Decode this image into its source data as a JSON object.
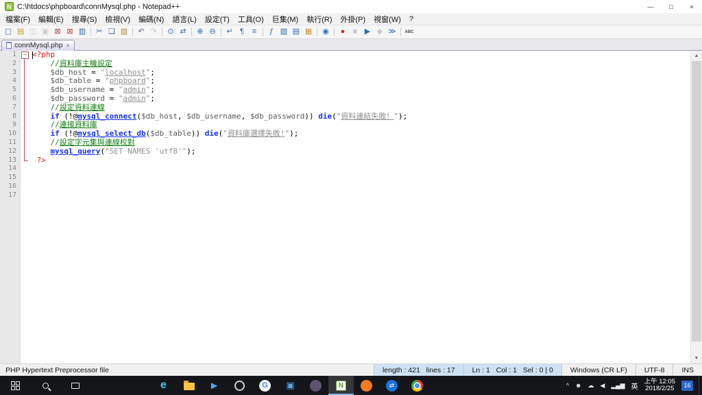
{
  "titlebar": {
    "icon_letter": "N",
    "title": "C:\\htdocs\\phpboard\\connMysql.php - Notepad++",
    "minimize_glyph": "—",
    "maximize_glyph": "□",
    "close_glyph": "×"
  },
  "menubar": {
    "items": [
      {
        "key": "file",
        "label": "檔案(F)"
      },
      {
        "key": "edit",
        "label": "編輯(E)"
      },
      {
        "key": "search",
        "label": "搜尋(S)"
      },
      {
        "key": "view",
        "label": "檢視(V)"
      },
      {
        "key": "encoding",
        "label": "編碼(N)"
      },
      {
        "key": "language",
        "label": "語言(L)"
      },
      {
        "key": "settings",
        "label": "設定(T)"
      },
      {
        "key": "tools",
        "label": "工具(O)"
      },
      {
        "key": "macro",
        "label": "巨集(M)"
      },
      {
        "key": "run",
        "label": "執行(R)"
      },
      {
        "key": "plugins",
        "label": "外掛(P)"
      },
      {
        "key": "window",
        "label": "視窗(W)"
      },
      {
        "key": "help",
        "label": "?"
      }
    ]
  },
  "toolbar": {
    "items": [
      {
        "name": "new-file",
        "glyph": "▢",
        "color": "#3a66a8"
      },
      {
        "name": "open-file",
        "glyph": "▤",
        "color": "#c79a3a"
      },
      {
        "name": "save-file",
        "glyph": "◫",
        "color": "#8a8a8a",
        "disabled": true
      },
      {
        "name": "save-all",
        "glyph": "▣",
        "color": "#8a8a8a",
        "disabled": true
      },
      {
        "name": "close-file",
        "glyph": "⊠",
        "color": "#b04a4a"
      },
      {
        "name": "close-all",
        "glyph": "⊠",
        "color": "#b04a4a"
      },
      {
        "name": "print",
        "glyph": "▥",
        "color": "#3a66a8"
      },
      {
        "sep": true
      },
      {
        "name": "cut",
        "glyph": "✂",
        "color": "#3a66a8"
      },
      {
        "name": "copy",
        "glyph": "❏",
        "color": "#3a66a8"
      },
      {
        "name": "paste",
        "glyph": "▨",
        "color": "#b58a3a"
      },
      {
        "sep": true
      },
      {
        "name": "undo",
        "glyph": "↶",
        "color": "#7d5bb5"
      },
      {
        "name": "redo",
        "glyph": "↷",
        "color": "#8a8a8a",
        "disabled": true
      },
      {
        "sep": true
      },
      {
        "name": "find",
        "glyph": "⊙",
        "color": "#2f6db3"
      },
      {
        "name": "replace",
        "glyph": "⇄",
        "color": "#2f6db3"
      },
      {
        "sep": true
      },
      {
        "name": "zoom-in",
        "glyph": "⊕",
        "color": "#2f6db3"
      },
      {
        "name": "zoom-out",
        "glyph": "⊖",
        "color": "#2f6db3"
      },
      {
        "sep": true
      },
      {
        "name": "word-wrap",
        "glyph": "↵",
        "color": "#2f6db3"
      },
      {
        "name": "show-all-characters",
        "glyph": "¶",
        "color": "#2f6db3"
      },
      {
        "name": "indent-guide",
        "glyph": "≡",
        "color": "#2f6db3"
      },
      {
        "sep": true
      },
      {
        "name": "function-list",
        "glyph": "ƒ",
        "color": "#2f6db3"
      },
      {
        "name": "document-map",
        "glyph": "▧",
        "color": "#2f6db3"
      },
      {
        "name": "document-list",
        "glyph": "▤",
        "color": "#2f6db3"
      },
      {
        "name": "folder-as-workspace",
        "glyph": "▦",
        "color": "#c79a3a"
      },
      {
        "sep": true
      },
      {
        "name": "monitoring",
        "glyph": "◉",
        "color": "#2f6db3"
      },
      {
        "sep": true
      },
      {
        "name": "record-macro",
        "glyph": "●",
        "color": "#cc2a2a"
      },
      {
        "name": "stop-recording",
        "glyph": "■",
        "color": "#8a8a8a",
        "disabled": true
      },
      {
        "name": "playback-macro",
        "glyph": "▶",
        "color": "#2f6db3"
      },
      {
        "name": "save-macro",
        "glyph": "◆",
        "color": "#8a8a8a",
        "disabled": true
      },
      {
        "name": "run-macro-multiple",
        "glyph": "≫",
        "color": "#2f6db3"
      },
      {
        "sep": true
      },
      {
        "name": "spell-check",
        "glyph": "ABC",
        "color": "#444444",
        "fs": 6,
        "bold": true
      }
    ]
  },
  "tabbar": {
    "label": "connMysql.php",
    "close_glyph": "×"
  },
  "editor": {
    "scrollbar": {
      "up": "▲",
      "down": "▼"
    },
    "lines": [
      {
        "num": 1,
        "fold": "start",
        "tokens": [
          {
            "t": "<?php",
            "c": "tag"
          }
        ]
      },
      {
        "num": 2,
        "fold": "line",
        "tokens": [
          {
            "t": "    ",
            "c": "op"
          },
          {
            "t": "//",
            "c": "com"
          },
          {
            "t": "資料庫主機設定",
            "c": "com u"
          }
        ]
      },
      {
        "num": 3,
        "fold": "line",
        "tokens": [
          {
            "t": "    ",
            "c": "op"
          },
          {
            "t": "$db_host",
            "c": "var"
          },
          {
            "t": " = ",
            "c": "op"
          },
          {
            "t": "\"",
            "c": "str"
          },
          {
            "t": "localhost",
            "c": "str u"
          },
          {
            "t": "\"",
            "c": "str"
          },
          {
            "t": ";",
            "c": "op"
          }
        ]
      },
      {
        "num": 4,
        "fold": "line",
        "tokens": [
          {
            "t": "    ",
            "c": "op"
          },
          {
            "t": "$db_table",
            "c": "var"
          },
          {
            "t": " = ",
            "c": "op"
          },
          {
            "t": "\"",
            "c": "str"
          },
          {
            "t": "phpboard",
            "c": "str u"
          },
          {
            "t": "\"",
            "c": "str"
          },
          {
            "t": ";",
            "c": "op"
          }
        ]
      },
      {
        "num": 5,
        "fold": "line",
        "tokens": [
          {
            "t": "    ",
            "c": "op"
          },
          {
            "t": "$db_username",
            "c": "var"
          },
          {
            "t": " = ",
            "c": "op"
          },
          {
            "t": "\"",
            "c": "str"
          },
          {
            "t": "admin",
            "c": "str u"
          },
          {
            "t": "\"",
            "c": "str"
          },
          {
            "t": ";",
            "c": "op"
          }
        ]
      },
      {
        "num": 6,
        "fold": "line",
        "tokens": [
          {
            "t": "    ",
            "c": "op"
          },
          {
            "t": "$db_password",
            "c": "var"
          },
          {
            "t": " = ",
            "c": "op"
          },
          {
            "t": "\"",
            "c": "str"
          },
          {
            "t": "admin",
            "c": "str u"
          },
          {
            "t": "\"",
            "c": "str"
          },
          {
            "t": ";",
            "c": "op"
          }
        ]
      },
      {
        "num": 7,
        "fold": "line",
        "tokens": [
          {
            "t": "    ",
            "c": "op"
          },
          {
            "t": "//",
            "c": "com"
          },
          {
            "t": "設定資料連線",
            "c": "com u"
          }
        ]
      },
      {
        "num": 8,
        "fold": "line",
        "tokens": [
          {
            "t": "    ",
            "c": "op"
          },
          {
            "t": "if",
            "c": "kw"
          },
          {
            "t": " (!@",
            "c": "op"
          },
          {
            "t": "mysql_connect",
            "c": "fn u"
          },
          {
            "t": "(",
            "c": "op"
          },
          {
            "t": "$db_host",
            "c": "var"
          },
          {
            "t": ", ",
            "c": "op"
          },
          {
            "t": "$db_username",
            "c": "var"
          },
          {
            "t": ", ",
            "c": "op"
          },
          {
            "t": "$db_password",
            "c": "var"
          },
          {
            "t": ")) ",
            "c": "op"
          },
          {
            "t": "die",
            "c": "kw"
          },
          {
            "t": "(",
            "c": "op"
          },
          {
            "t": "\"",
            "c": "str"
          },
          {
            "t": "資料連結失敗！",
            "c": "str u"
          },
          {
            "t": "\"",
            "c": "str"
          },
          {
            "t": ");",
            "c": "op"
          }
        ]
      },
      {
        "num": 9,
        "fold": "line",
        "tokens": [
          {
            "t": "    ",
            "c": "op"
          },
          {
            "t": "//",
            "c": "com"
          },
          {
            "t": "連接資料庫",
            "c": "com u"
          }
        ]
      },
      {
        "num": 10,
        "fold": "line",
        "tokens": [
          {
            "t": "    ",
            "c": "op"
          },
          {
            "t": "if",
            "c": "kw"
          },
          {
            "t": " (!@",
            "c": "op"
          },
          {
            "t": "mysql_select_db",
            "c": "fn u"
          },
          {
            "t": "(",
            "c": "op"
          },
          {
            "t": "$db_table",
            "c": "var"
          },
          {
            "t": ")) ",
            "c": "op"
          },
          {
            "t": "die",
            "c": "kw"
          },
          {
            "t": "(",
            "c": "op"
          },
          {
            "t": "\"",
            "c": "str"
          },
          {
            "t": "資料庫選擇失敗!",
            "c": "str u"
          },
          {
            "t": "\"",
            "c": "str"
          },
          {
            "t": ");",
            "c": "op"
          }
        ]
      },
      {
        "num": 11,
        "fold": "line",
        "tokens": [
          {
            "t": "    ",
            "c": "op"
          },
          {
            "t": "//",
            "c": "com"
          },
          {
            "t": "設定字元集與連線校對",
            "c": "com u"
          }
        ]
      },
      {
        "num": 12,
        "fold": "line",
        "tokens": [
          {
            "t": "    ",
            "c": "op"
          },
          {
            "t": "mysql_query",
            "c": "fn u"
          },
          {
            "t": "(",
            "c": "op"
          },
          {
            "t": "\"SET NAMES 'utf8'\"",
            "c": "str"
          },
          {
            "t": ");",
            "c": "op"
          }
        ]
      },
      {
        "num": 13,
        "fold": "end",
        "tokens": [
          {
            "t": " ",
            "c": "op"
          },
          {
            "t": "?>",
            "c": "tag"
          }
        ]
      },
      {
        "num": 14,
        "fold": "none",
        "tokens": []
      },
      {
        "num": 15,
        "fold": "none",
        "tokens": []
      },
      {
        "num": 16,
        "fold": "none",
        "tokens": []
      },
      {
        "num": 17,
        "fold": "none",
        "tokens": []
      }
    ]
  },
  "statusbar": {
    "doctype": "PHP Hypertext Preprocessor file",
    "length_lines": "length : 421   lines : 17",
    "cursor": "Ln : 1   Col : 1   Sel : 0 | 0",
    "eol": "Windows (CR LF)",
    "encoding": "UTF-8",
    "mode": "INS"
  },
  "taskbar": {
    "apps": [
      {
        "name": "edge",
        "kind": "glyph",
        "glyph": "e",
        "color": "#45c8f5",
        "size": 16,
        "bold": true
      },
      {
        "name": "file-explorer",
        "kind": "folder"
      },
      {
        "name": "media-player",
        "kind": "glyph",
        "glyph": "▶",
        "color": "#53a7ea",
        "size": 12
      },
      {
        "name": "settings",
        "kind": "ring"
      },
      {
        "name": "google",
        "kind": "disc",
        "bg": "#f4f4f4",
        "glyph": "G",
        "color": "#4285f4",
        "size": 11,
        "bold": true
      },
      {
        "name": "photos",
        "kind": "glyph",
        "glyph": "▣",
        "color": "#53a7ea",
        "size": 13
      },
      {
        "name": "dark-app",
        "kind": "disc",
        "bg": "#5f5370"
      },
      {
        "name": "notepad-plus-plus",
        "kind": "npp",
        "glyph": "N",
        "color": "#4a9a1f",
        "size": 10,
        "bold": true,
        "active": true
      },
      {
        "name": "xampp",
        "kind": "disc",
        "bg": "#fb7a24"
      },
      {
        "name": "teamviewer",
        "kind": "disc",
        "bg": "#1a73d9",
        "glyph": "⇄",
        "color": "#ffffff",
        "size": 9
      },
      {
        "name": "chrome",
        "kind": "chrome"
      }
    ],
    "tray": {
      "icons": [
        {
          "name": "hidden-icons-chevron",
          "glyph": "^"
        },
        {
          "name": "user-icon",
          "glyph": "☻"
        },
        {
          "name": "onedrive-icon",
          "glyph": "☁"
        },
        {
          "name": "volume-icon",
          "glyph": "◀"
        },
        {
          "name": "network-icon",
          "glyph": "▂▄▆"
        }
      ],
      "ime": "英",
      "time": "上午 12:05",
      "date": "2018/2/25",
      "notification_count": "16"
    }
  }
}
